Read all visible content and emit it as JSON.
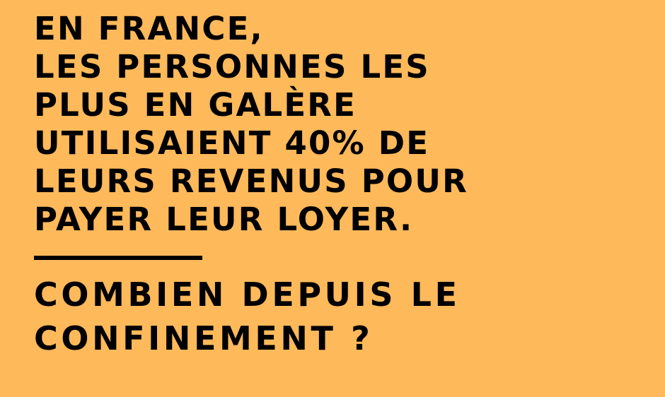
{
  "background_color": "#FDB95A",
  "text_color": "#000000",
  "statement": {
    "lines": [
      "EN FRANCE,",
      "LES PERSONNES LES",
      "PLUS EN GALÈRE",
      "UTILISAIENT 40% DE",
      "LEURS REVENUS POUR",
      "PAYER LEUR LOYER."
    ]
  },
  "question": {
    "lines": [
      "COMBIEN DEPUIS LE",
      "CONFINEMENT ?"
    ]
  }
}
